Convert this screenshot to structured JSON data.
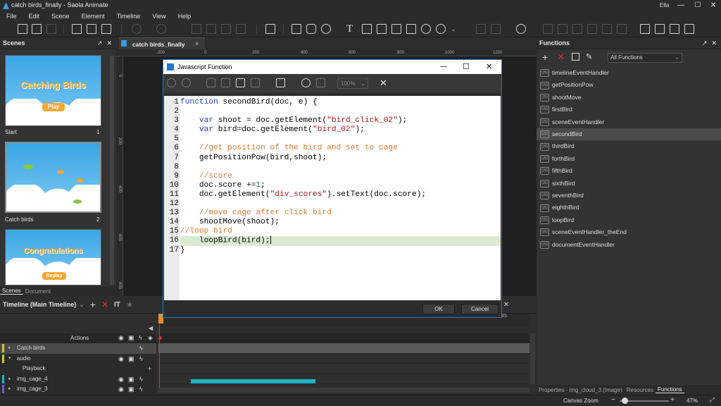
{
  "window": {
    "title": "catch birds_finally - Saola Animate",
    "user": "Ella",
    "minimize": "—",
    "maximize": "☐",
    "close": "✕"
  },
  "menu": [
    "File",
    "Edit",
    "Scene",
    "Element",
    "Timeline",
    "View",
    "Help"
  ],
  "toolbar_icons": [
    "new-file-icon",
    "open-file-icon",
    "save-icon",
    "scene-add-icon",
    "scene-new-icon",
    "html-icon",
    "undo-icon",
    "redo-icon",
    "cut-icon",
    "copy-icon",
    "paste-icon",
    "delete-icon",
    "group-icon",
    "rectangle-icon",
    "rounded-rectangle-icon",
    "ellipse-icon",
    "text-icon",
    "text-box-icon",
    "image-icon",
    "video-icon",
    "audio-icon",
    "html-widget-icon",
    "preview-icon"
  ],
  "scenes_panel": {
    "title": "Scenes",
    "scenes": [
      {
        "name": "Start",
        "number": "1",
        "art_title": "Catching Birds",
        "art_button": "Play"
      },
      {
        "name": "Catch birds",
        "number": "2"
      },
      {
        "name": "",
        "number": "",
        "art_title": "Congratulations",
        "art_button": "Replay"
      }
    ],
    "tabs": [
      "Scenes",
      "Document"
    ]
  },
  "document_tab": {
    "label": "catch birds_finally",
    "close": "×"
  },
  "ruler": {
    "h_ticks": [
      "-200",
      "0",
      "200",
      "400",
      "600",
      "800",
      "1000",
      "1200"
    ],
    "v_ticks": [
      "0",
      "200",
      "400",
      "600",
      "800"
    ]
  },
  "dialog": {
    "title": "Javascript Function",
    "zoom": "100%",
    "ok_label": "OK",
    "cancel_label": "Cancel",
    "code_lines": [
      {
        "n": "1",
        "fold": "▼"
      },
      {
        "n": "2"
      },
      {
        "n": "3"
      },
      {
        "n": "4"
      },
      {
        "n": "5"
      },
      {
        "n": "6"
      },
      {
        "n": "7"
      },
      {
        "n": "8"
      },
      {
        "n": "9"
      },
      {
        "n": "10"
      },
      {
        "n": "11"
      },
      {
        "n": "12"
      },
      {
        "n": "13"
      },
      {
        "n": "14"
      },
      {
        "n": "15"
      },
      {
        "n": "16"
      },
      {
        "n": "17"
      }
    ],
    "code": {
      "l1a": "function",
      "l1b": " secondBird(doc, e) {",
      "l3a": "    var",
      "l3b": " shoot = doc.getElement(",
      "l3c": "\"bird_click_02\"",
      "l3d": ");",
      "l4a": "    var",
      "l4b": " bird=doc.getElement(",
      "l4c": "\"bird_02\"",
      "l4d": ");",
      "l6": "    //get position of the bird and set to cage",
      "l7": "    getPositionPow(bird,shoot);",
      "l9": "    //score",
      "l10a": "    doc.score +=",
      "l10b": "1",
      "l10c": ";",
      "l11a": "    doc.getElement(",
      "l11b": "\"div_scores\"",
      "l11c": ").setText(doc.score);",
      "l13": "    //move cage after click bird",
      "l14": "    shootMove(shoot);",
      "l15": "//loop bird",
      "l16": "    loopBird(bird);",
      "l17": "}"
    }
  },
  "functions_panel": {
    "title": "Functions",
    "filter": "All Functions",
    "selected": "secondBird",
    "items": [
      "timelineEventHandler",
      "getPositionPow",
      "shootMove",
      "firstBird",
      "sceneEventHandler",
      "secondBird",
      "thirdBird",
      "forthBird",
      "fifthBird",
      "sixthBird",
      "seventhBird",
      "eighthBird",
      "loopBird",
      "sceneEventHandler_theEnd",
      "documentEventHandler"
    ],
    "bottom_tabs": [
      "Properties - img_cloud_3 (Image)",
      "Resources",
      "Functions"
    ]
  },
  "timeline": {
    "title": "Timeline (Main Timeline)",
    "tick_45": "45",
    "actions_label": "Actions",
    "rows": [
      {
        "name": "Catch birds",
        "indent": 1
      },
      {
        "name": "audio",
        "indent": 1
      },
      {
        "name": "Playback",
        "indent": 2
      },
      {
        "name": "img_cage_4",
        "indent": 1
      },
      {
        "name": "img_cage_3",
        "indent": 1
      }
    ]
  },
  "status": {
    "canvas_zoom_label": "Canvas Zoom",
    "zoom_value": "47%",
    "minus": "−",
    "plus": "+"
  },
  "colors": {
    "accent": "#1e7ad1",
    "selection_row": "#4b4b4b",
    "code_highlight": "#d9ecd2",
    "playhead": "#e8902a",
    "cage_bar": "#1fb5c8"
  }
}
